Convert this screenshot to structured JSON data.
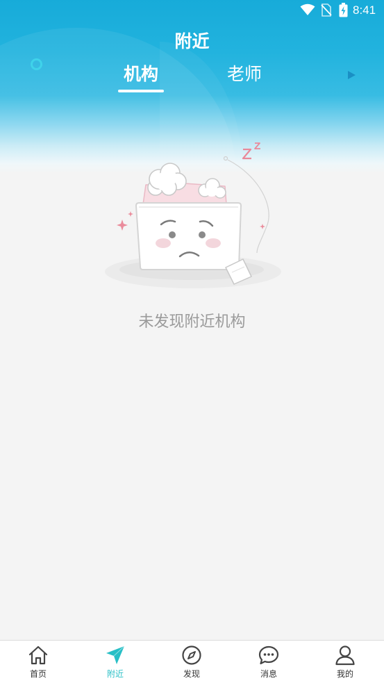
{
  "status_bar": {
    "time": "8:41",
    "icons": [
      "wifi-icon",
      "no-sim-icon",
      "battery-charging-icon"
    ]
  },
  "header": {
    "title": "附近",
    "tabs": [
      {
        "label": "机构",
        "active": true
      },
      {
        "label": "老师",
        "active": false
      }
    ]
  },
  "empty_state": {
    "illustration": "empty-box-sad-face-icon",
    "message": "未发现附近机构"
  },
  "bottom_nav": {
    "items": [
      {
        "label": "首页",
        "icon": "home-icon",
        "active": false
      },
      {
        "label": "附近",
        "icon": "location-arrow-icon",
        "active": true
      },
      {
        "label": "发现",
        "icon": "compass-icon",
        "active": false
      },
      {
        "label": "消息",
        "icon": "chat-bubble-icon",
        "active": false
      },
      {
        "label": "我的",
        "icon": "user-icon",
        "active": false
      }
    ]
  },
  "colors": {
    "header_top": "#17abd9",
    "accent_active": "#28bfc6",
    "background": "#f4f4f4",
    "muted_text": "#9a9a9a",
    "nav_text": "#333333",
    "white": "#ffffff"
  }
}
